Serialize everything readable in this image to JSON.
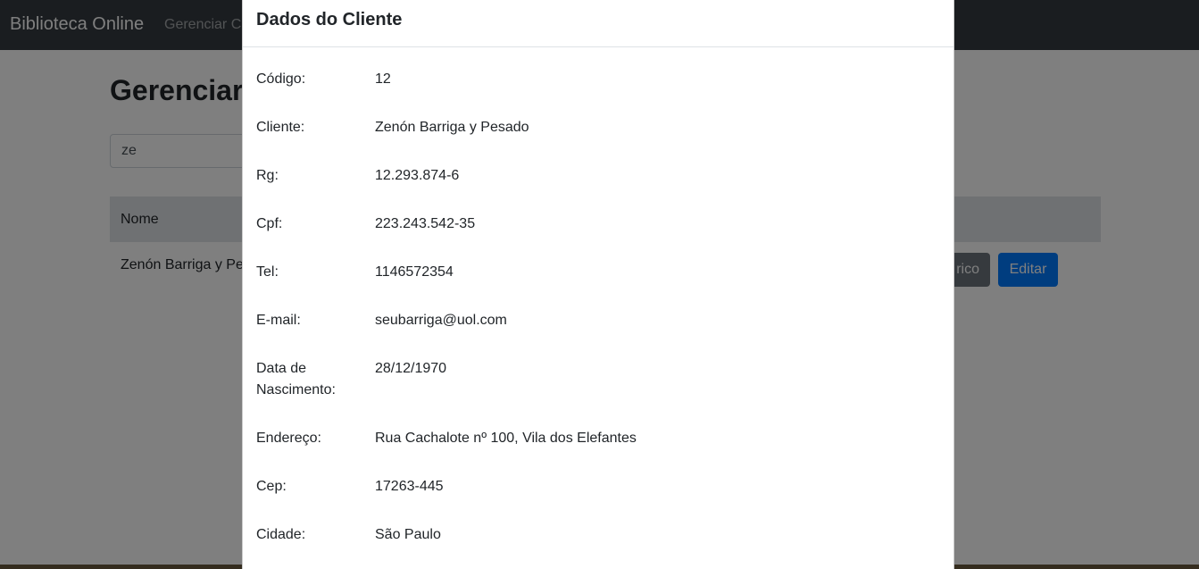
{
  "navbar": {
    "brand": "Biblioteca Online",
    "nav_link": "Gerenciar Cl"
  },
  "main": {
    "title": "Gerenciar",
    "search_value": "ze",
    "table": {
      "headers": [
        "Nome"
      ],
      "rows": [
        {
          "name": "Zenón Barriga y Pes",
          "history_label": "rico",
          "edit_label": "Editar"
        }
      ]
    }
  },
  "modal": {
    "title": "Dados do Cliente",
    "fields": [
      {
        "label": "Código:",
        "value": "12"
      },
      {
        "label": "Cliente:",
        "value": "Zenón Barriga y Pesado"
      },
      {
        "label": "Rg:",
        "value": "12.293.874-6"
      },
      {
        "label": "Cpf:",
        "value": "223.243.542-35"
      },
      {
        "label": "Tel:",
        "value": "1146572354"
      },
      {
        "label": "E-mail:",
        "value": "seubarriga@uol.com"
      },
      {
        "label": "Data de Nascimento:",
        "value": "28/12/1970"
      },
      {
        "label": "Endereço:",
        "value": "Rua Cachalote nº 100, Vila dos Elefantes"
      },
      {
        "label": "Cep:",
        "value": "17263-445"
      },
      {
        "label": "Cidade:",
        "value": "São Paulo"
      }
    ]
  },
  "colors": {
    "navbar_bg": "#343a40",
    "primary": "#007bff",
    "secondary": "#6c757d",
    "backdrop": "rgba(0,0,0,0.5)"
  }
}
